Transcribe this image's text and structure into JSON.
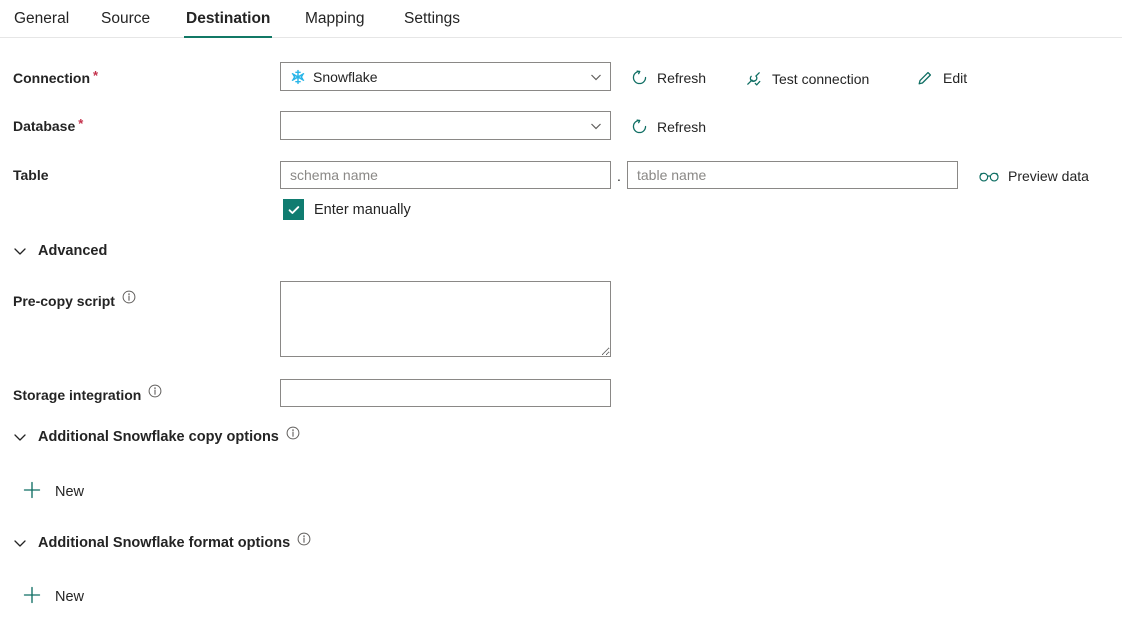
{
  "tabs": [
    {
      "label": "General",
      "active": false
    },
    {
      "label": "Source",
      "active": false
    },
    {
      "label": "Destination",
      "active": true
    },
    {
      "label": "Mapping",
      "active": false
    },
    {
      "label": "Settings",
      "active": false
    }
  ],
  "colors": {
    "accent_teal": "#117865",
    "checkbox_teal": "#107c70",
    "icon_teal": "#0f6e63",
    "snowflake_blue": "#29b5e8",
    "required_red": "#c4314b",
    "border_gray": "#8a8886",
    "placeholder_gray": "#8a8886",
    "text": "#242424"
  },
  "form": {
    "connection": {
      "label": "Connection",
      "required": true,
      "value": "Snowflake",
      "icon": "snowflake-icon",
      "actions": [
        {
          "label": "Refresh",
          "icon": "refresh-icon"
        },
        {
          "label": "Test connection",
          "icon": "plug-check-icon"
        },
        {
          "label": "Edit",
          "icon": "pencil-icon"
        }
      ]
    },
    "database": {
      "label": "Database",
      "required": true,
      "value": "",
      "actions": [
        {
          "label": "Refresh",
          "icon": "refresh-icon"
        }
      ]
    },
    "table": {
      "label": "Table",
      "required": false,
      "schema_placeholder": "schema name",
      "schema_value": "",
      "separator": ".",
      "table_placeholder": "table name",
      "table_value": "",
      "actions": [
        {
          "label": "Preview data",
          "icon": "glasses-icon"
        }
      ]
    },
    "enter_manually": {
      "label": "Enter manually",
      "checked": true,
      "icon": "checkmark-icon"
    }
  },
  "advanced": {
    "label": "Advanced",
    "expanded": true,
    "chevron": "chevron-down-icon",
    "pre_copy_script": {
      "label": "Pre-copy script",
      "info_icon": "info-icon",
      "value": "",
      "placeholder": ""
    },
    "storage_integration": {
      "label": "Storage integration",
      "info_icon": "info-icon",
      "value": "",
      "placeholder": ""
    },
    "copy_options": {
      "label": "Additional Snowflake copy options",
      "info_icon": "info-icon",
      "expanded": true,
      "chevron": "chevron-down-icon",
      "new_button": {
        "label": "New",
        "icon": "plus-icon"
      }
    },
    "format_options": {
      "label": "Additional Snowflake format options",
      "info_icon": "info-icon",
      "expanded": true,
      "chevron": "chevron-down-icon",
      "new_button": {
        "label": "New",
        "icon": "plus-icon"
      }
    }
  }
}
